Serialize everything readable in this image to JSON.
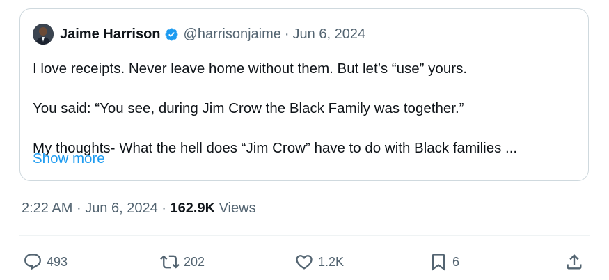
{
  "quoted_post": {
    "author_name": "Jaime Harrison",
    "handle": "@harrisonjaime",
    "separator": "·",
    "date": "Jun 6, 2024",
    "lines": [
      "I love receipts.  Never leave home without them. But let’s “use” yours.",
      "You said: “You see, during Jim Crow the Black Family was together.”",
      "My thoughts-  What the hell does “Jim Crow” have to do with Black families ..."
    ],
    "show_more": "Show more"
  },
  "meta": {
    "time": "2:22 AM",
    "sep1": "·",
    "date": "Jun 6, 2024",
    "sep2": "·",
    "views_count": "162.9K",
    "views_label": "Views"
  },
  "actions": {
    "replies": "493",
    "reposts": "202",
    "likes": "1.2K",
    "bookmarks": "6"
  },
  "colors": {
    "accent": "#1d9bf0",
    "secondary_text": "#536471",
    "border": "#cfd9de"
  },
  "icons": [
    "verified-badge-icon",
    "reply-icon",
    "repost-icon",
    "like-icon",
    "bookmark-icon",
    "share-icon"
  ]
}
